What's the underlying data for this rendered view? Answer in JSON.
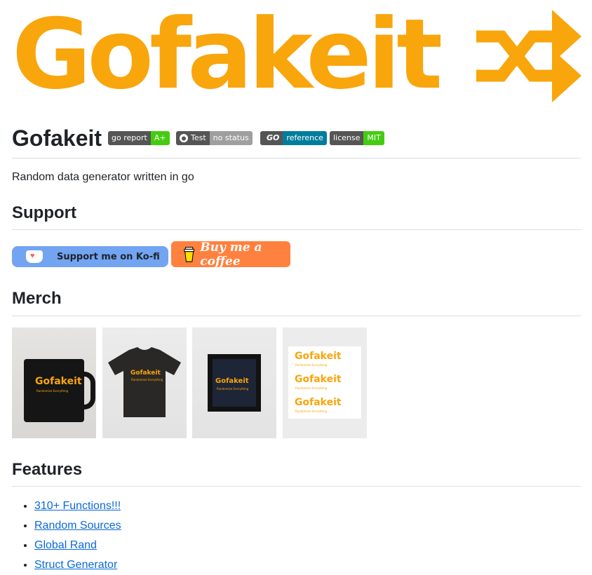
{
  "banner": {
    "logo_text": "Gofakeit",
    "shuffle_icon": "shuffle-icon",
    "accent_color": "#f9a50c"
  },
  "header": {
    "title": "Gofakeit",
    "badges": [
      {
        "left": "go report",
        "right": "A+",
        "right_color": "#44cc11"
      },
      {
        "left": "Test",
        "right": "no status",
        "right_color": "#9f9f9f",
        "icon": "github-icon"
      },
      {
        "left": "GO",
        "right": "reference",
        "right_color": "#007d9c",
        "icon": "go-icon"
      },
      {
        "left": "license",
        "right": "MIT",
        "right_color": "#4c1"
      }
    ]
  },
  "description": "Random data generator written in go",
  "sections": {
    "support": "Support",
    "merch": "Merch",
    "features": "Features"
  },
  "support": {
    "kofi_label": "Support me on Ko-fi",
    "bmc_label": "Buy me a coffee"
  },
  "merch_items": [
    {
      "name": "mug",
      "logo_text": "Gofakeit",
      "tagline": "Randomize Everything"
    },
    {
      "name": "t-shirt",
      "logo_text": "Gofakeit",
      "tagline": "Randomize Everything"
    },
    {
      "name": "poster",
      "logo_text": "Gofakeit",
      "tagline": "Randomize Everything"
    },
    {
      "name": "stickers",
      "logo_text": "Gofakeit",
      "tagline": "Randomize Everything"
    }
  ],
  "features": [
    "310+ Functions!!!",
    "Random Sources",
    "Global Rand",
    "Struct Generator"
  ]
}
